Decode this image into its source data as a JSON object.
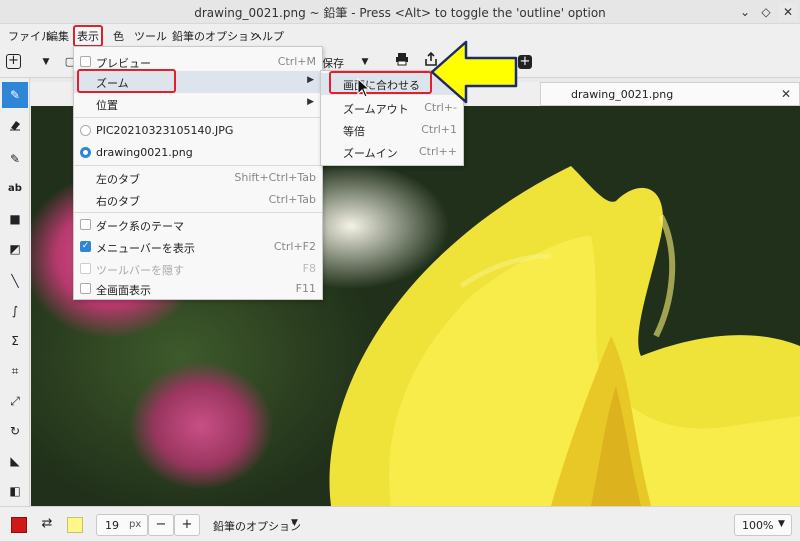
{
  "window": {
    "title": "drawing_0021.png ~ 鉛筆 - Press <Alt> to toggle the 'outline' option",
    "min": "⌄",
    "max": "◇",
    "close": "✕"
  },
  "menubar": [
    "ファイル",
    "編集",
    "表示",
    "色",
    "ツール",
    "鉛筆のオプション",
    "ヘルプ"
  ],
  "toolbar": {
    "add": "+",
    "save_partial": "保存",
    "add2": "+"
  },
  "tab": {
    "label": "drawing_0021.png",
    "close": "✕"
  },
  "view_menu": {
    "preview": {
      "label": "プレビュー",
      "accel": "Ctrl+M"
    },
    "zoom": {
      "label": "ズーム"
    },
    "position": {
      "label": "位置"
    },
    "image1": {
      "label": "PIC20210323105140.JPG"
    },
    "image2": {
      "label": "drawing0021.png"
    },
    "left_tab": {
      "label": "左のタブ",
      "accel": "Shift+Ctrl+Tab"
    },
    "right_tab": {
      "label": "右のタブ",
      "accel": "Ctrl+Tab"
    },
    "dark_theme": {
      "label": "ダーク系のテーマ"
    },
    "show_menubar": {
      "label": "メニューバーを表示",
      "accel": "Ctrl+F2"
    },
    "hide_toolbar": {
      "label": "ツールバーを隠す",
      "accel": "F8"
    },
    "fullscreen": {
      "label": "全画面表示",
      "accel": "F11"
    }
  },
  "zoom_menu": {
    "fit": {
      "label": "画面に合わせる"
    },
    "zoom_out": {
      "label": "ズームアウト",
      "accel": "Ctrl+-"
    },
    "actual": {
      "label": "等倍",
      "accel": "Ctrl+1"
    },
    "zoom_in": {
      "label": "ズームイン",
      "accel": "Ctrl++"
    }
  },
  "bottombar": {
    "size_value": "19",
    "size_unit": "px",
    "minus": "−",
    "plus": "+",
    "tool_options": "鉛筆のオプション",
    "zoom_level": "100%"
  },
  "colors": {
    "accent": "#2f86d6",
    "highlight_red": "#e0202a",
    "primary_color": "#d01818",
    "secondary_color": "#fff68a",
    "arrow_yellow": "#ffff00"
  }
}
